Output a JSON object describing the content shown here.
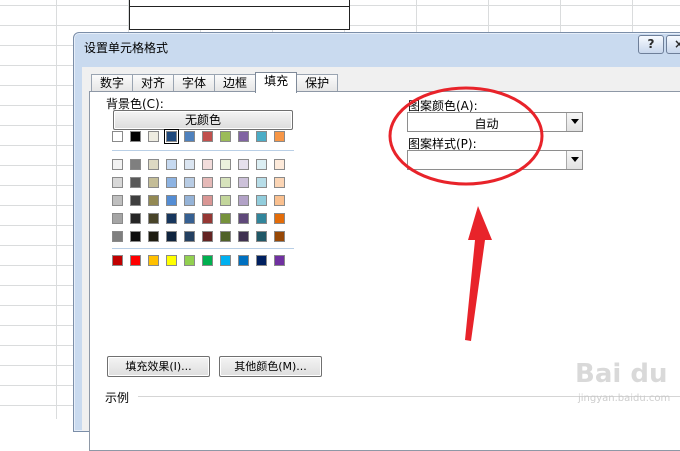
{
  "dialog": {
    "title": "设置单元格格式",
    "help_label": "?",
    "close_label": "×"
  },
  "tabs": [
    {
      "label": "数字"
    },
    {
      "label": "对齐"
    },
    {
      "label": "字体"
    },
    {
      "label": "边框"
    },
    {
      "label": "填充",
      "active": true
    },
    {
      "label": "保护"
    }
  ],
  "fill": {
    "background_color_label": "背景色(C):",
    "no_color_button": "无颜色",
    "fill_effects_button": "填充效果(I)...",
    "more_colors_button": "其他颜色(M)...",
    "pattern_color_label": "图案颜色(A):",
    "pattern_color_value": "自动",
    "pattern_style_label": "图案样式(P):",
    "pattern_style_value": "",
    "sample_label": "示例"
  },
  "palette": {
    "theme_top": [
      "#ffffff",
      "#000000",
      "#eeece1",
      "#1f497d",
      "#4f81bd",
      "#c0504d",
      "#9bbb59",
      "#8064a2",
      "#4bacc6",
      "#f79646"
    ],
    "theme_tints": [
      [
        "#f2f2f2",
        "#7f7f7f",
        "#ddd9c3",
        "#c6d9f0",
        "#dbe5f1",
        "#f2dcdb",
        "#ebf1dd",
        "#e5e0ec",
        "#dbeef3",
        "#fdeada"
      ],
      [
        "#d8d8d8",
        "#595959",
        "#c4bd97",
        "#8db3e2",
        "#b8cce4",
        "#e5b9b7",
        "#d7e3bc",
        "#ccc1d9",
        "#b7dde8",
        "#fbd5b5"
      ],
      [
        "#bfbfbf",
        "#3f3f3f",
        "#938953",
        "#548dd4",
        "#95b3d7",
        "#d99694",
        "#c3d69b",
        "#b2a2c7",
        "#92cddc",
        "#fac08f"
      ],
      [
        "#a5a5a5",
        "#262626",
        "#494429",
        "#17365d",
        "#366092",
        "#953734",
        "#76923c",
        "#5f497a",
        "#31859b",
        "#e36c09"
      ],
      [
        "#7f7f7f",
        "#0c0c0c",
        "#1d1b10",
        "#0f243e",
        "#244061",
        "#632423",
        "#4f6128",
        "#3f3151",
        "#205867",
        "#974806"
      ]
    ],
    "standard": [
      "#c00000",
      "#ff0000",
      "#ffc000",
      "#ffff00",
      "#92d050",
      "#00b050",
      "#00b0f0",
      "#0070c0",
      "#002060",
      "#7030a0"
    ],
    "selected": "#1f497d"
  },
  "annotation": {
    "color": "#e8232a"
  },
  "watermark": {
    "text": "Bai du",
    "sub": "jingyan.baidu.com"
  }
}
